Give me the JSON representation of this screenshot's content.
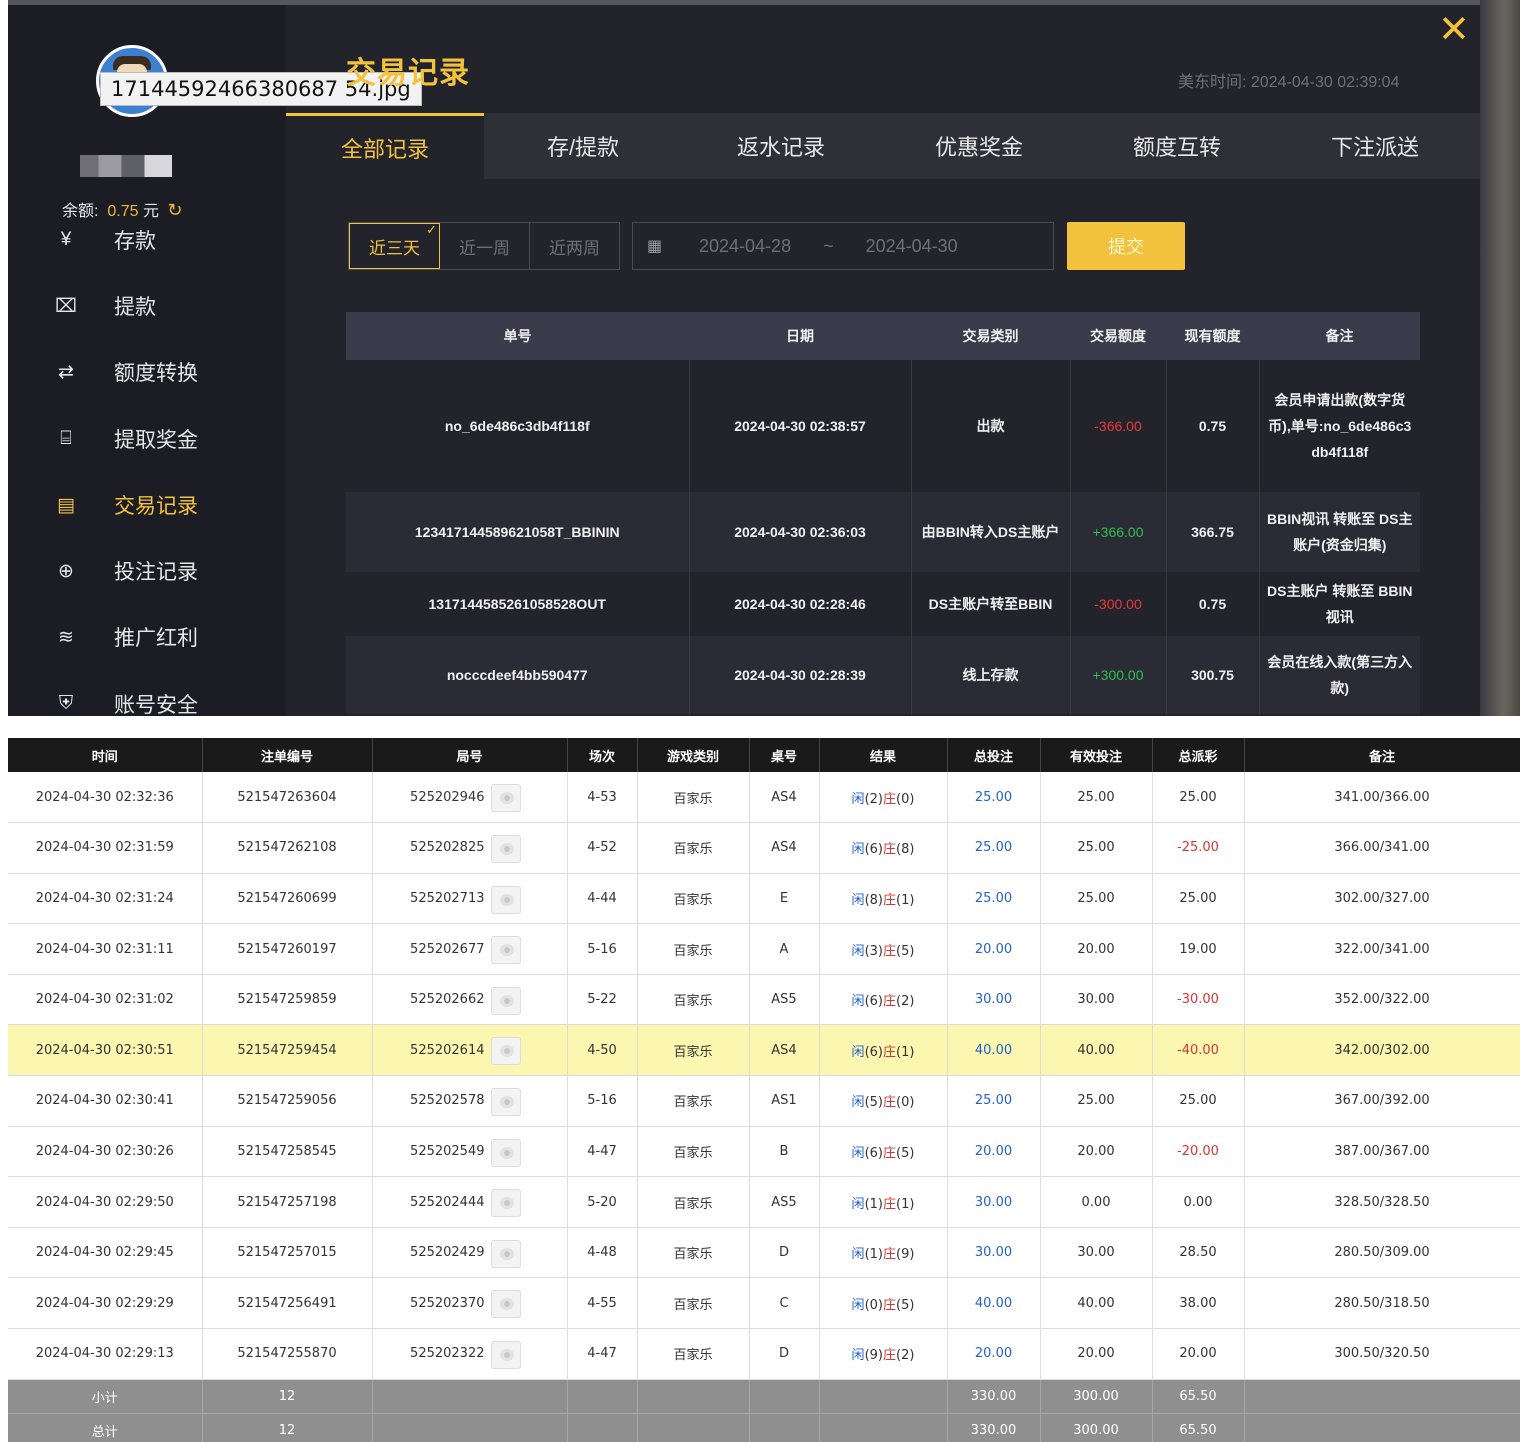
{
  "file_chip": "17144592466380687 54.jpg",
  "sidebar": {
    "balance_label": "余额:",
    "balance_value": "0.75",
    "balance_unit": "元",
    "refresh_glyph": "↻",
    "items": [
      {
        "label": "存款",
        "icon": "yen-circle-icon",
        "glyph": "¥"
      },
      {
        "label": "提款",
        "icon": "cash-icon",
        "glyph": "⌧"
      },
      {
        "label": "额度转换",
        "icon": "exchange-icon",
        "glyph": "⇄"
      },
      {
        "label": "提取奖金",
        "icon": "gift-icon",
        "glyph": "⌸"
      },
      {
        "label": "交易记录",
        "icon": "clipboard-icon",
        "glyph": "▤",
        "active": true
      },
      {
        "label": "投注记录",
        "icon": "search-record-icon",
        "glyph": "⊕"
      },
      {
        "label": "推广红利",
        "icon": "coins-icon",
        "glyph": "≋"
      },
      {
        "label": "账号安全",
        "icon": "shield-icon",
        "glyph": "⛨"
      }
    ]
  },
  "header": {
    "title": "交易记录",
    "time_label": "美东时间:",
    "time_value": "2024-04-30 02:39:04",
    "close_glyph": "✕"
  },
  "tabs": [
    "全部记录",
    "存/提款",
    "返水记录",
    "优惠奖金",
    "额度互转",
    "下注派送"
  ],
  "filters": {
    "ranges": [
      "近三天",
      "近一周",
      "近两周"
    ],
    "check_glyph": "✓",
    "date_from": "2024-04-28",
    "date_sep": "~",
    "date_to": "2024-04-30",
    "submit": "提交"
  },
  "txn_table": {
    "headers": [
      "单号",
      "日期",
      "交易类别",
      "交易额度",
      "现有额度",
      "备注"
    ],
    "rows": [
      {
        "id": "no_6de486c3db4f118f",
        "date": "2024-04-30 02:38:57",
        "type": "出款",
        "amount": "-366.00",
        "balance": "0.75",
        "note": "会员申请出款(数字货币),单号:no_6de486c3db4f118f"
      },
      {
        "id": "123417144589621058T_BBININ",
        "date": "2024-04-30 02:36:03",
        "type": "由BBIN转入DS主账户",
        "amount": "+366.00",
        "balance": "366.75",
        "note": "BBIN视讯 转账至 DS主账户(资金归集)"
      },
      {
        "id": "1317144585261058528OUT",
        "date": "2024-04-30 02:28:46",
        "type": "DS主账户转至BBIN",
        "amount": "-300.00",
        "balance": "0.75",
        "note": "DS主账户 转账至 BBIN视讯"
      },
      {
        "id": "nocccdeef4bb590477",
        "date": "2024-04-30 02:28:39",
        "type": "线上存款",
        "amount": "+300.00",
        "balance": "300.75",
        "note": "会员在线入款(第三方入款)"
      }
    ]
  },
  "bets_table": {
    "headers": [
      "时间",
      "注单编号",
      "局号",
      "场次",
      "游戏类别",
      "桌号",
      "结果",
      "总投注",
      "有效投注",
      "总派彩",
      "备注"
    ],
    "result_labels": {
      "player": "闲",
      "banker": "庄"
    },
    "rows": [
      {
        "time": "2024-04-30 02:32:36",
        "bet_no": "521547263604",
        "round": "525202946",
        "shoe": "4-53",
        "game": "百家乐",
        "table": "AS4",
        "p": "2",
        "b": "0",
        "total": "25.00",
        "valid": "25.00",
        "payout": "25.00",
        "note": "341.00/366.00"
      },
      {
        "time": "2024-04-30 02:31:59",
        "bet_no": "521547262108",
        "round": "525202825",
        "shoe": "4-52",
        "game": "百家乐",
        "table": "AS4",
        "p": "6",
        "b": "8",
        "total": "25.00",
        "valid": "25.00",
        "payout": "-25.00",
        "note": "366.00/341.00"
      },
      {
        "time": "2024-04-30 02:31:24",
        "bet_no": "521547260699",
        "round": "525202713",
        "shoe": "4-44",
        "game": "百家乐",
        "table": "E",
        "p": "8",
        "b": "1",
        "total": "25.00",
        "valid": "25.00",
        "payout": "25.00",
        "note": "302.00/327.00"
      },
      {
        "time": "2024-04-30 02:31:11",
        "bet_no": "521547260197",
        "round": "525202677",
        "shoe": "5-16",
        "game": "百家乐",
        "table": "A",
        "p": "3",
        "b": "5",
        "total": "20.00",
        "valid": "20.00",
        "payout": "19.00",
        "note": "322.00/341.00"
      },
      {
        "time": "2024-04-30 02:31:02",
        "bet_no": "521547259859",
        "round": "525202662",
        "shoe": "5-22",
        "game": "百家乐",
        "table": "AS5",
        "p": "6",
        "b": "2",
        "total": "30.00",
        "valid": "30.00",
        "payout": "-30.00",
        "note": "352.00/322.00"
      },
      {
        "time": "2024-04-30 02:30:51",
        "bet_no": "521547259454",
        "round": "525202614",
        "shoe": "4-50",
        "game": "百家乐",
        "table": "AS4",
        "p": "6",
        "b": "1",
        "total": "40.00",
        "valid": "40.00",
        "payout": "-40.00",
        "note": "342.00/302.00",
        "highlight": true
      },
      {
        "time": "2024-04-30 02:30:41",
        "bet_no": "521547259056",
        "round": "525202578",
        "shoe": "5-16",
        "game": "百家乐",
        "table": "AS1",
        "p": "5",
        "b": "0",
        "total": "25.00",
        "valid": "25.00",
        "payout": "25.00",
        "note": "367.00/392.00"
      },
      {
        "time": "2024-04-30 02:30:26",
        "bet_no": "521547258545",
        "round": "525202549",
        "shoe": "4-47",
        "game": "百家乐",
        "table": "B",
        "p": "6",
        "b": "5",
        "total": "20.00",
        "valid": "20.00",
        "payout": "-20.00",
        "note": "387.00/367.00"
      },
      {
        "time": "2024-04-30 02:29:50",
        "bet_no": "521547257198",
        "round": "525202444",
        "shoe": "5-20",
        "game": "百家乐",
        "table": "AS5",
        "p": "1",
        "b": "1",
        "total": "30.00",
        "valid": "0.00",
        "payout": "0.00",
        "note": "328.50/328.50"
      },
      {
        "time": "2024-04-30 02:29:45",
        "bet_no": "521547257015",
        "round": "525202429",
        "shoe": "4-48",
        "game": "百家乐",
        "table": "D",
        "p": "1",
        "b": "9",
        "total": "30.00",
        "valid": "30.00",
        "payout": "28.50",
        "note": "280.50/309.00"
      },
      {
        "time": "2024-04-30 02:29:29",
        "bet_no": "521547256491",
        "round": "525202370",
        "shoe": "4-55",
        "game": "百家乐",
        "table": "C",
        "p": "0",
        "b": "5",
        "total": "40.00",
        "valid": "40.00",
        "payout": "38.00",
        "note": "280.50/318.50"
      },
      {
        "time": "2024-04-30 02:29:13",
        "bet_no": "521547255870",
        "round": "525202322",
        "shoe": "4-47",
        "game": "百家乐",
        "table": "D",
        "p": "9",
        "b": "2",
        "total": "20.00",
        "valid": "20.00",
        "payout": "20.00",
        "note": "300.50/320.50"
      }
    ],
    "subtotal": {
      "label": "小计",
      "count": "12",
      "total": "330.00",
      "valid": "300.00",
      "payout": "65.50"
    },
    "grand_total": {
      "label": "总计",
      "count": "12",
      "total": "330.00",
      "valid": "300.00",
      "payout": "65.50"
    }
  }
}
